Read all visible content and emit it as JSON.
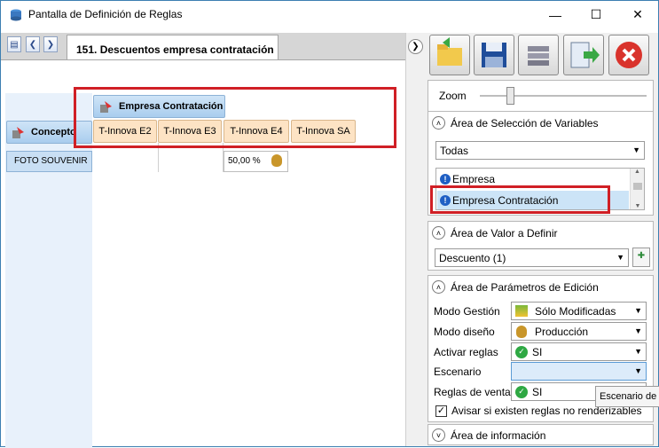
{
  "window": {
    "title": "Pantalla de Definición de Reglas"
  },
  "tab": {
    "title": "151. Descuentos empresa contratación"
  },
  "grid": {
    "group_header": "Empresa Contratación",
    "concept_header": "Concepto",
    "columns": [
      "T-Innova E2",
      "T-Innova E3",
      "T-Innova E4",
      "T-Innova SA"
    ],
    "rows": [
      {
        "label": "FOTO SOUVENIR",
        "value": "50,00 %"
      }
    ]
  },
  "toolbar": {
    "zoom_label": "Zoom"
  },
  "variables": {
    "title": "Área de Selección de Variables",
    "filter": "Todas",
    "items": [
      "Empresa",
      "Empresa Contratación"
    ]
  },
  "value_panel": {
    "title": "Área de Valor a Definir",
    "selected": "Descuento (1)"
  },
  "params": {
    "title": "Área de Parámetros de Edición",
    "modo_gestion_label": "Modo Gestión",
    "modo_gestion_value": "Sólo Modificadas",
    "modo_diseno_label": "Modo diseño",
    "modo_diseno_value": "Producción",
    "activar_label": "Activar reglas",
    "activar_value": "SI",
    "escenario_label": "Escenario",
    "reglas_venta_label": "Reglas de venta",
    "reglas_venta_value": "SI",
    "avisar_label": "Avisar si existen reglas no renderizables"
  },
  "info": {
    "title": "Área de información"
  },
  "tooltip": "Escenario de",
  "colors": {
    "accent_red": "#d01f25",
    "header_blue": "#a9cdee",
    "header_peach": "#fde3c4"
  }
}
